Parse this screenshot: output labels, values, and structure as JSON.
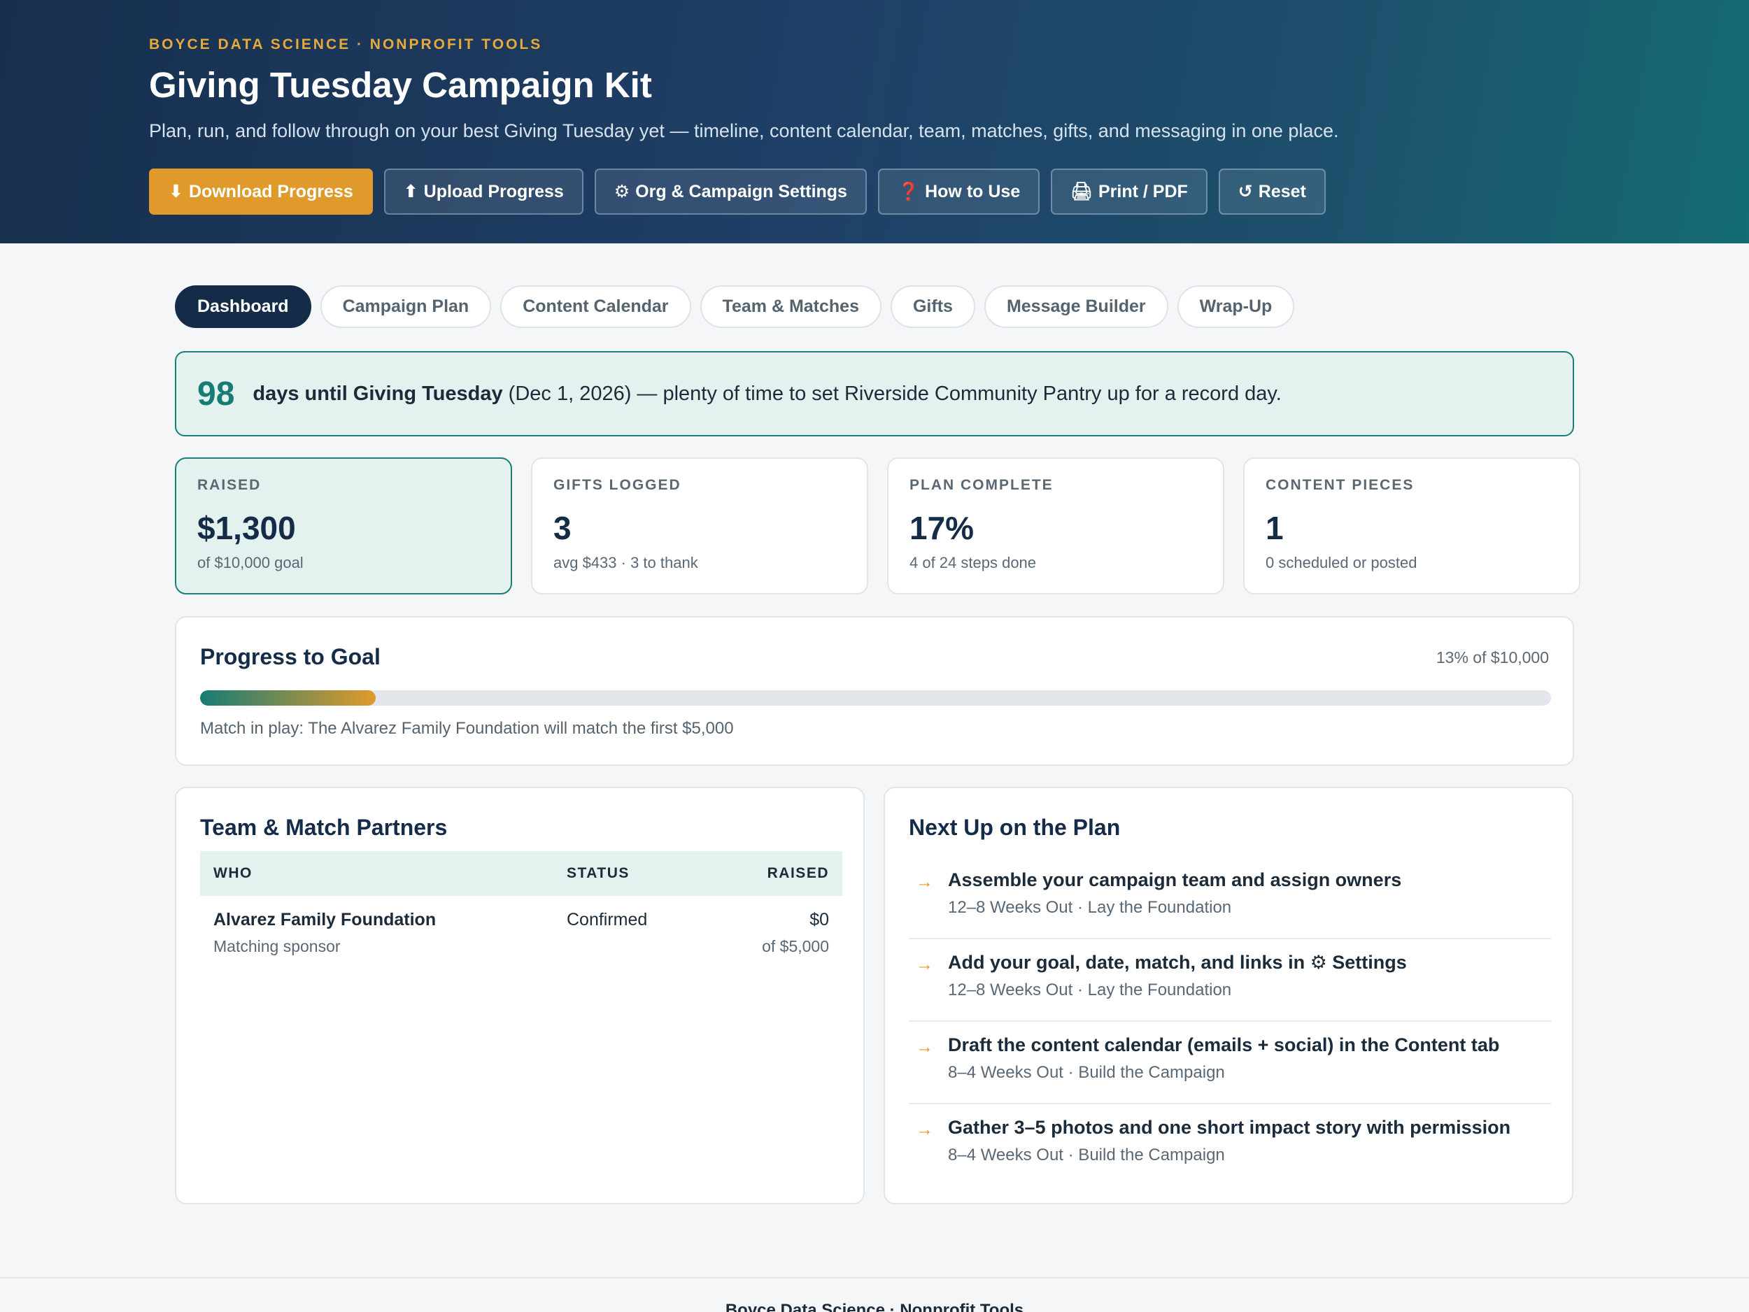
{
  "header": {
    "eyebrow": "BOYCE DATA SCIENCE · NONPROFIT TOOLS",
    "title": "Giving Tuesday Campaign Kit",
    "subtitle": "Plan, run, and follow through on your best Giving Tuesday yet — timeline, content calendar, team, matches, gifts, and messaging in one place.",
    "buttons": [
      {
        "icon": "⬇",
        "icon_name": "download-icon",
        "label": "Download Progress"
      },
      {
        "icon": "⬆",
        "icon_name": "upload-icon",
        "label": "Upload Progress"
      },
      {
        "icon": "⚙",
        "icon_name": "gear-icon",
        "label": "Org & Campaign Settings"
      },
      {
        "icon": "❓",
        "icon_name": "question-icon",
        "label": "How to Use"
      },
      {
        "icon": "🖨",
        "icon_name": "printer-icon",
        "label": "Print / PDF"
      },
      {
        "icon": "↺",
        "icon_name": "reset-icon",
        "label": "Reset"
      }
    ]
  },
  "tabs": [
    "Dashboard",
    "Campaign Plan",
    "Content Calendar",
    "Team & Matches",
    "Gifts",
    "Message Builder",
    "Wrap-Up"
  ],
  "active_tab": "Dashboard",
  "countdown": {
    "days": "98",
    "bold_text": "days until Giving Tuesday",
    "rest_text": " (Dec 1, 2026) — plenty of time to set Riverside Community Pantry up for a record day."
  },
  "stats": [
    {
      "label": "RAISED",
      "value": "$1,300",
      "sub": "of $10,000 goal"
    },
    {
      "label": "GIFTS LOGGED",
      "value": "3",
      "sub": "avg $433 · 3 to thank"
    },
    {
      "label": "PLAN COMPLETE",
      "value": "17%",
      "sub": "4 of 24 steps done"
    },
    {
      "label": "CONTENT PIECES",
      "value": "1",
      "sub": "0 scheduled or posted"
    }
  ],
  "progress": {
    "title": "Progress to Goal",
    "summary": "13% of $10,000",
    "percent": 13,
    "note": "Match in play: The Alvarez Family Foundation will match the first $5,000"
  },
  "team": {
    "title": "Team & Match Partners",
    "columns": {
      "who": "WHO",
      "status": "STATUS",
      "raised": "RAISED"
    },
    "rows": [
      {
        "name": "Alvarez Family Foundation",
        "role": "Matching sponsor",
        "status": "Confirmed",
        "raised": "$0",
        "raised_of": "of $5,000"
      }
    ]
  },
  "plan": {
    "title": "Next Up on the Plan",
    "items": [
      {
        "title": "Assemble your campaign team and assign owners",
        "meta": "12–8 Weeks Out · Lay the Foundation"
      },
      {
        "title": "Add your goal, date, match, and links in ⚙ Settings",
        "meta": "12–8 Weeks Out · Lay the Foundation"
      },
      {
        "title": "Draft the content calendar (emails + social) in the Content tab",
        "meta": "8–4 Weeks Out · Build the Campaign"
      },
      {
        "title": "Gather 3–5 photos and one short impact story with permission",
        "meta": "8–4 Weeks Out · Build the Campaign"
      }
    ]
  },
  "footer": {
    "text": "Boyce Data Science · Nonprofit Tools"
  }
}
